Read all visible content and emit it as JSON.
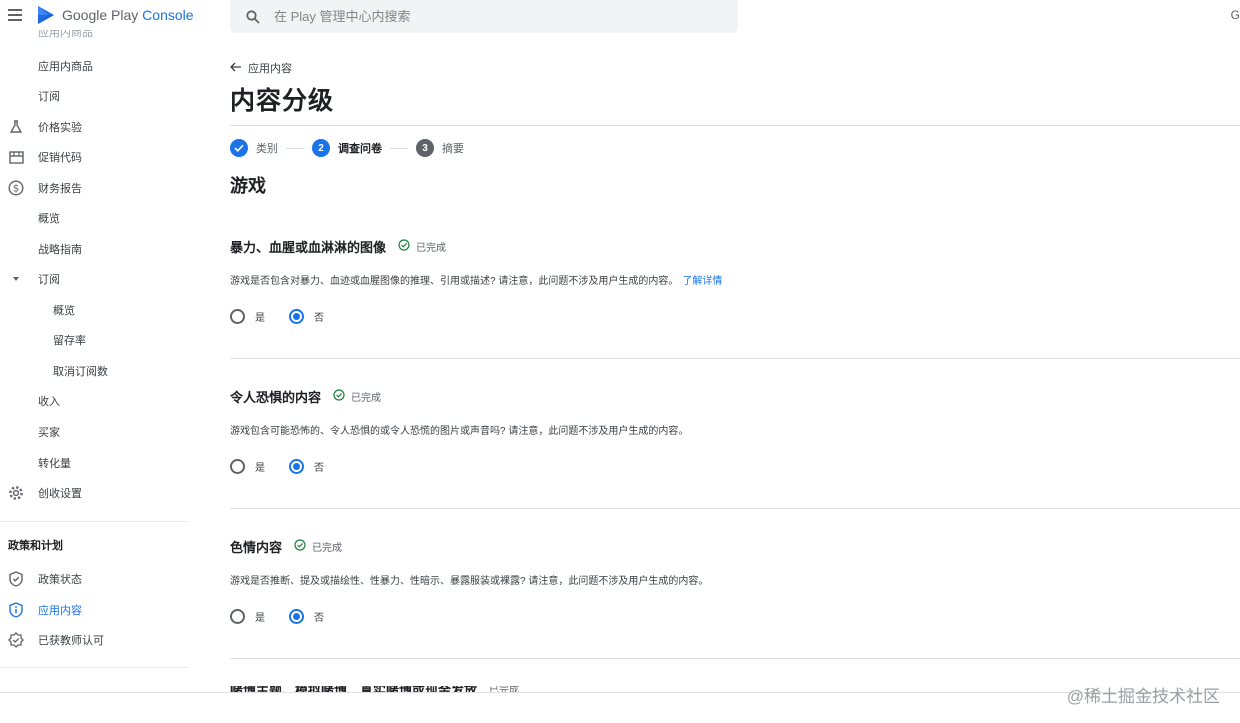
{
  "app": {
    "logo_text": "Google Play",
    "logo_console": "Console"
  },
  "search": {
    "placeholder": "在 Play 管理中心内搜索"
  },
  "sidebar": {
    "cut_item": "应用内商品",
    "items": [
      {
        "label": "应用内商品"
      },
      {
        "label": "订阅"
      },
      {
        "label": "价格实验"
      },
      {
        "label": "促销代码"
      },
      {
        "label": "财务报告"
      },
      {
        "label": "概览"
      },
      {
        "label": "战略指南"
      },
      {
        "label": "订阅"
      },
      {
        "label": "概览"
      },
      {
        "label": "留存率"
      },
      {
        "label": "取消订阅数"
      },
      {
        "label": "收入"
      },
      {
        "label": "买家"
      },
      {
        "label": "转化量"
      },
      {
        "label": "创收设置"
      }
    ],
    "policy_section": "政策和计划",
    "policy_items": [
      {
        "label": "政策状态"
      },
      {
        "label": "应用内容"
      },
      {
        "label": "已获教师认可"
      }
    ]
  },
  "main": {
    "back_label": "应用内容",
    "title": "内容分级",
    "steps": [
      {
        "number": "1",
        "label": "类别"
      },
      {
        "number": "2",
        "label": "调查问卷"
      },
      {
        "number": "3",
        "label": "摘要"
      }
    ],
    "section": "游戏",
    "questions": [
      {
        "title": "暴力、血腥或血淋淋的图像",
        "status": "已完成",
        "desc": "游戏是否包含对暴力、血迹或血腥图像的推理、引用或描述? 请注意，此问题不涉及用户生成的内容。",
        "link": "了解详情",
        "yes": "是",
        "no": "否"
      },
      {
        "title": "令人恐惧的内容",
        "status": "已完成",
        "desc": "游戏包含可能恐怖的、令人恐惧的或令人恐慌的图片或声音吗? 请注意，此问题不涉及用户生成的内容。",
        "yes": "是",
        "no": "否"
      },
      {
        "title": "色情内容",
        "status": "已完成",
        "desc": "游戏是否推断、提及或描绘性、性暴力、性暗示、暴露服装或裸露? 请注意，此问题不涉及用户生成的内容。",
        "yes": "是",
        "no": "否"
      }
    ],
    "peek_title": "赌博主题、模拟赌博、真实赌博或现金发放",
    "peek_status": "已完成"
  },
  "watermark": "@稀土掘金技术社区",
  "colors": {
    "accent": "#1a73e8",
    "success": "#188038"
  }
}
